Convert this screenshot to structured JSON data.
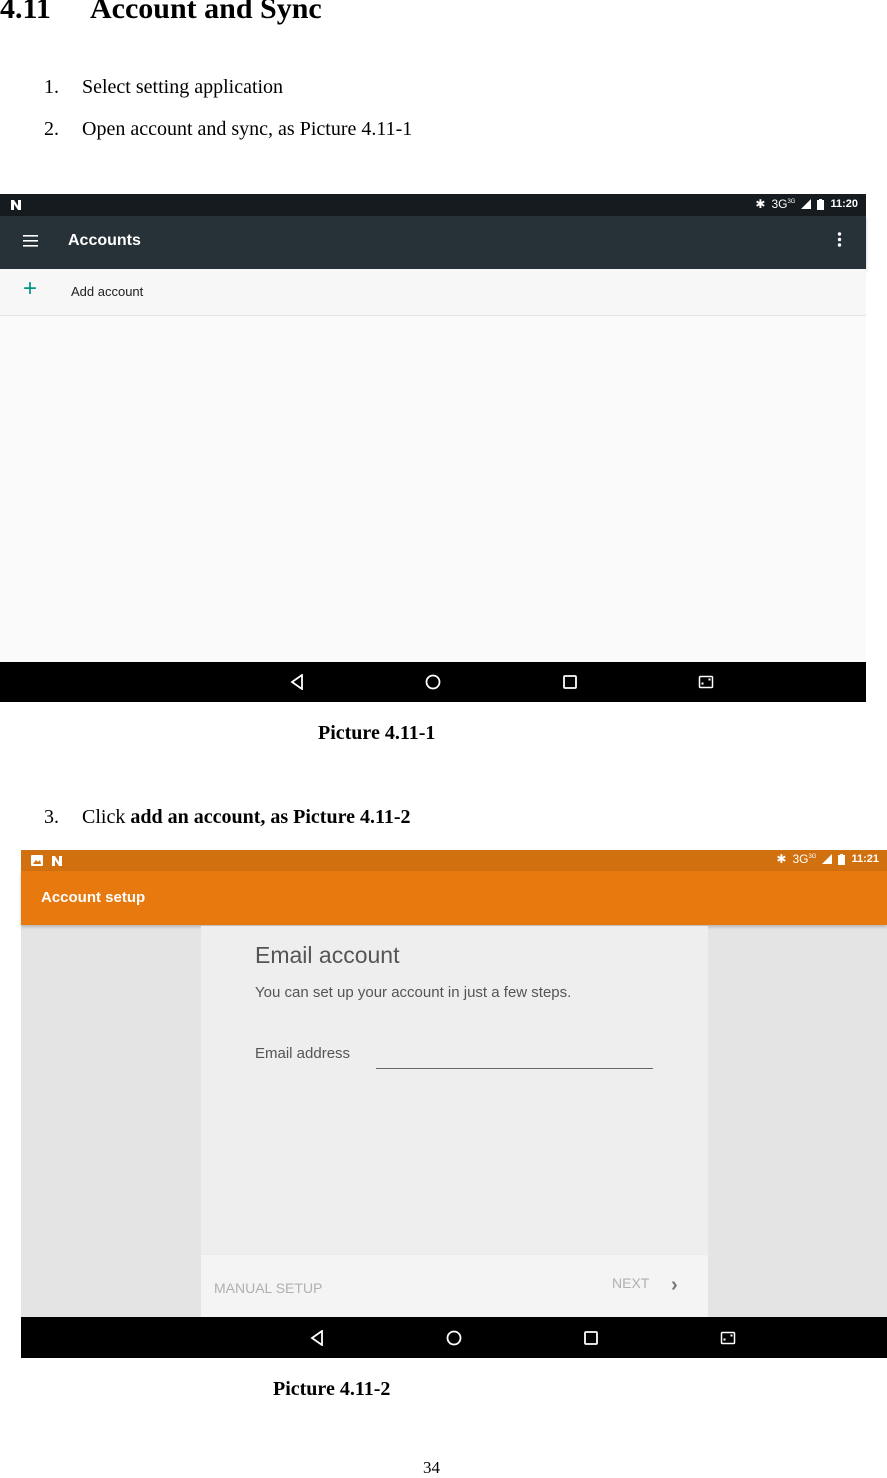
{
  "section": {
    "number": "4.11",
    "title": "Account and Sync"
  },
  "steps": [
    {
      "n": "1.",
      "text": "Select setting application"
    },
    {
      "n": "2.",
      "text": "Open account and sync, as Picture 4.11-1"
    },
    {
      "n": "3.",
      "text_plain": "Click ",
      "text_bold": "add an account, as Picture 4.11-2"
    }
  ],
  "picture1": {
    "caption": "Picture 4.11-1",
    "status_bar": {
      "left_icon": "n-notification-icon",
      "network": "3G",
      "network_sup": "3G",
      "time": "11:20"
    },
    "toolbar": {
      "title": "Accounts",
      "menu_icon": "hamburger-icon",
      "overflow_icon": "more-vert-icon"
    },
    "list": [
      {
        "icon": "plus-icon",
        "label": "Add account"
      }
    ],
    "navbar": [
      "back-icon",
      "home-icon",
      "recents-icon",
      "screenshot-icon"
    ],
    "colors": {
      "status": "#151b1e",
      "toolbar": "#263238",
      "accent": "#009688"
    }
  },
  "picture2": {
    "caption": "Picture 4.11-2",
    "status_bar": {
      "network": "3G",
      "network_sup": "3G",
      "time": "11:21"
    },
    "toolbar": {
      "title": "Account setup"
    },
    "card": {
      "title": "Email account",
      "subtitle": "You can set up your account in just a few steps.",
      "email_label": "Email address",
      "email_value": "",
      "manual_setup": "MANUAL SETUP",
      "next": "NEXT"
    },
    "colors": {
      "status": "#d1700f",
      "toolbar": "#e8790f"
    }
  },
  "page_number": "34"
}
